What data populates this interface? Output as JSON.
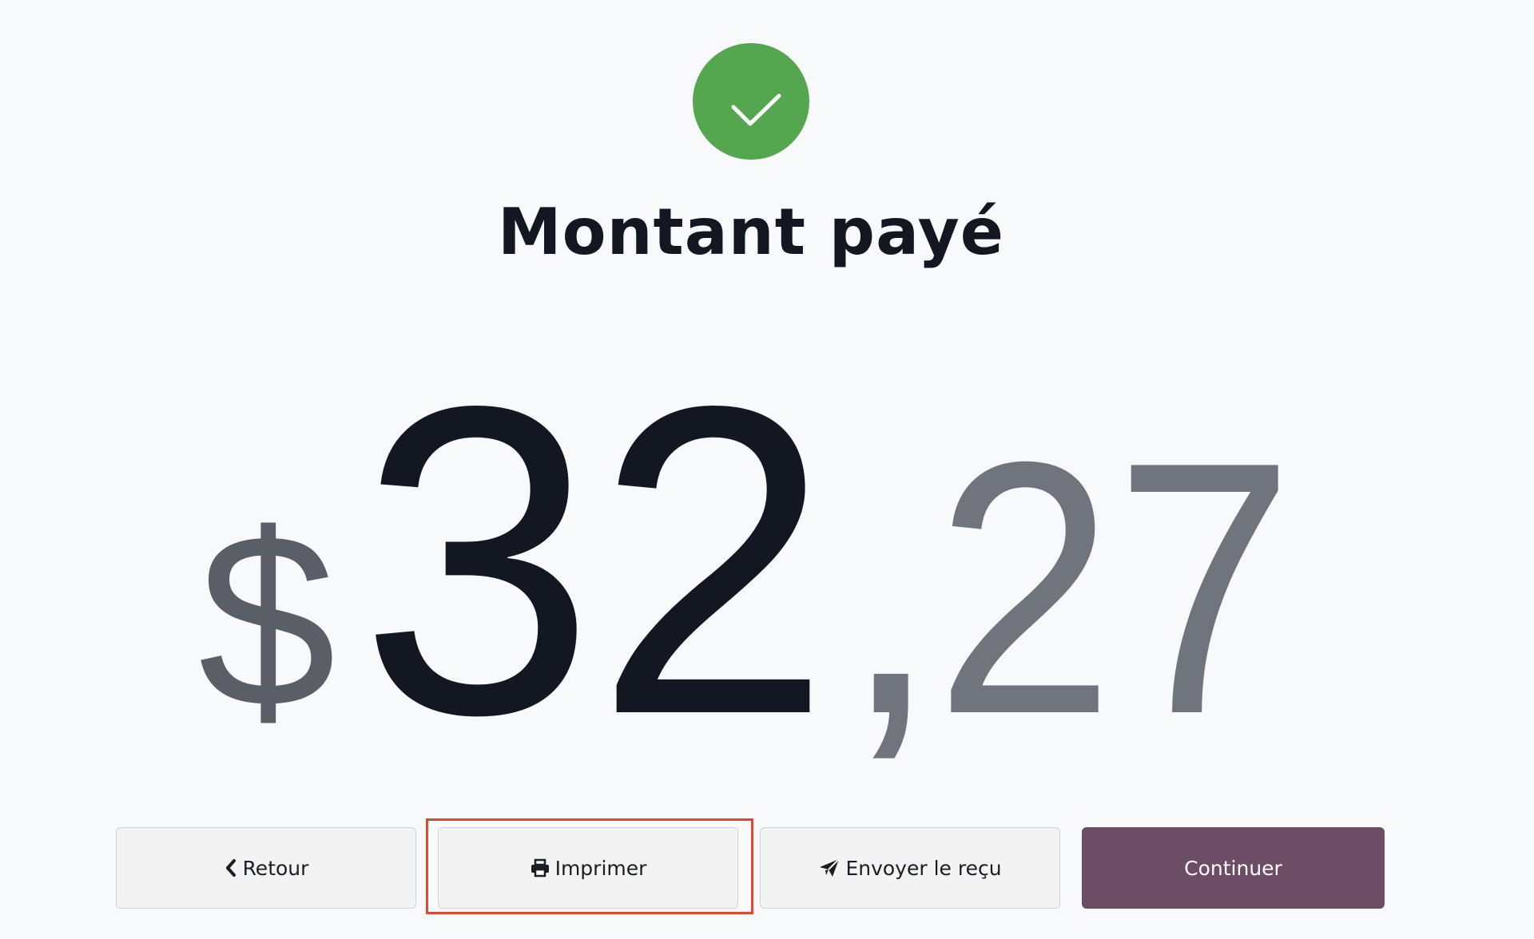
{
  "header": {
    "status_icon": "check-circle-icon",
    "title": "Montant payé"
  },
  "amount": {
    "currency_symbol": "$",
    "integer_part": "32",
    "separator": ",",
    "decimal_part": "27"
  },
  "colors": {
    "success": "#55a74f",
    "primary": "#6d4d66",
    "highlight": "#e1462f",
    "text_dark": "#131722",
    "text_muted": "#70747c"
  },
  "actions": {
    "back": {
      "label": "Retour",
      "icon": "chevron-left-icon"
    },
    "print": {
      "label": "Imprimer",
      "icon": "printer-icon"
    },
    "send": {
      "label": "Envoyer le reçu",
      "icon": "paper-plane-icon"
    },
    "continue": {
      "label": "Continuer"
    }
  }
}
